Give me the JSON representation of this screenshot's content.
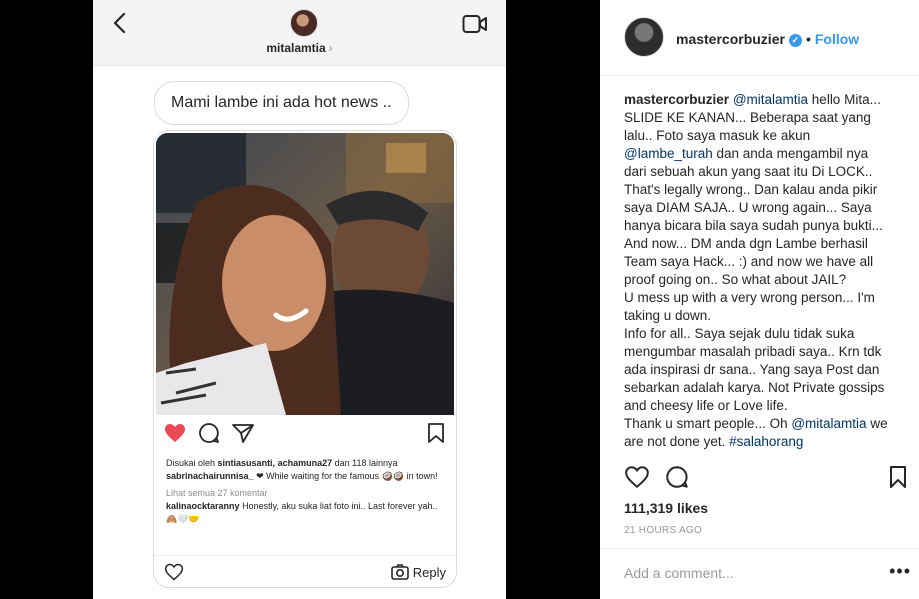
{
  "dm": {
    "username": "mitalamtia",
    "chevron": "›",
    "message": "Mami lambe ini ada hot news ..",
    "shared_post": {
      "liked_by_prefix": "Disukai oleh",
      "liked_by_users": "sintiasusanti, achamuna27",
      "liked_by_suffix": "dan 118 lainnya",
      "caption_user": "sabrinachairunnisa_",
      "caption_text": "❤ While waiting for the famous 🥥🥥 in town!",
      "view_comments": "Lihat semua 27 komentar",
      "comment_user": "kalinaocktaranny",
      "comment_text": "Honestly, aku suka liat foto ini.. Last forever yah.. 🙈🤍🤝"
    },
    "reply_label": "Reply",
    "icons": [
      "back-icon",
      "video-icon",
      "heart-filled-icon",
      "comment-icon",
      "share-icon",
      "bookmark-icon",
      "heart-outline-icon",
      "camera-icon"
    ],
    "colors": {
      "like_red": "#ed4956"
    }
  },
  "post": {
    "author": "mastercorbuzier",
    "dot": "•",
    "follow_label": "Follow",
    "caption": {
      "user": "mastercorbuzier",
      "mention1": "@mitalamtia",
      "part1": " hello Mita... SLIDE KE KANAN... Beberapa saat yang lalu.. Foto saya masuk ke akun ",
      "mention2": "@lambe_turah",
      "part2": " dan anda mengambil nya dari sebuah akun yang saat itu Di LOCK.. That's legally wrong.. Dan kalau anda pikir saya DIAM SAJA.. U wrong again... Saya hanya bicara bila saya sudah punya bukti... And now... DM anda dgn Lambe berhasil Team saya Hack... :) and now we have all proof going on.. So what about JAIL?",
      "line2": "U mess up with a very wrong person... I'm taking u down.",
      "line3": "Info for all.. Saya sejak dulu tidak suka mengumbar masalah pribadi saya.. Krn tdk ada inspirasi dr sana.. Yang saya Post dan sebarkan adalah karya. Not Private gossips and cheesy life or Love life.",
      "line4_pre": "Thank u smart people... Oh ",
      "mention3": "@mitalamtia",
      "line4_mid": " we are not done yet. ",
      "hashtag": "#salahorang"
    },
    "likes": "111,319 likes",
    "timestamp": "21 HOURS AGO",
    "comment_placeholder": "Add a comment...",
    "more": "•••",
    "colors": {
      "link": "#003569",
      "follow": "#3897f0"
    }
  }
}
